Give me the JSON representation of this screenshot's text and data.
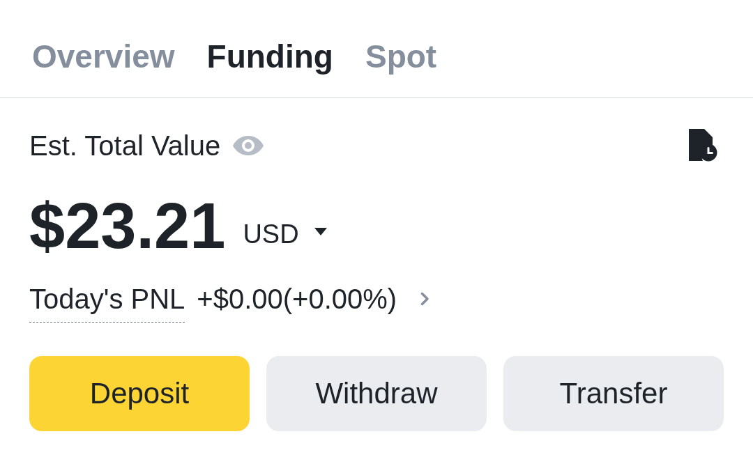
{
  "tabs": [
    {
      "label": "Overview",
      "selected": false
    },
    {
      "label": "Funding",
      "selected": true
    },
    {
      "label": "Spot",
      "selected": false
    }
  ],
  "balance": {
    "label": "Est. Total Value",
    "amount": "$23.21",
    "currency": "USD"
  },
  "pnl": {
    "label": "Today's PNL",
    "value": "+$0.00(+0.00%)"
  },
  "buttons": [
    {
      "label": "Deposit",
      "kind": "primary"
    },
    {
      "label": "Withdraw",
      "kind": "secondary"
    },
    {
      "label": "Transfer",
      "kind": "secondary"
    }
  ]
}
